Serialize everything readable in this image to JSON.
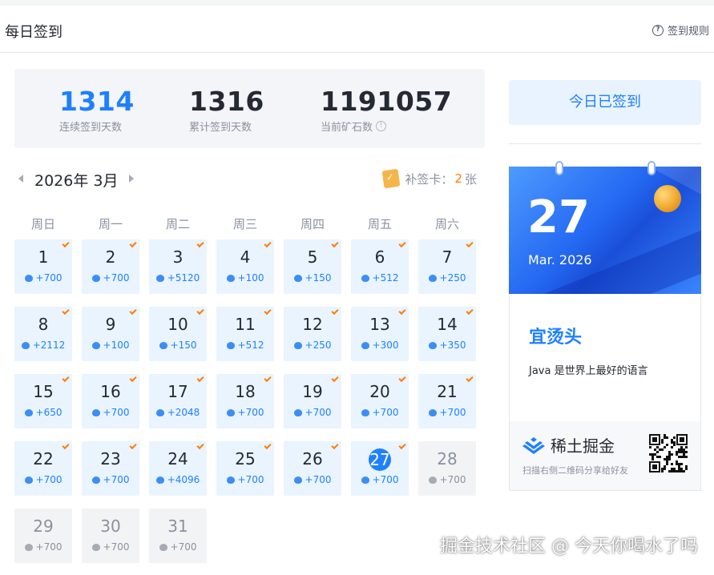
{
  "header": {
    "title": "每日签到",
    "rules_label": "签到规则"
  },
  "stats": [
    {
      "value": "1314",
      "label": "连续签到天数",
      "color": "#1e80ff"
    },
    {
      "value": "1316",
      "label": "累计签到天数",
      "color": "#252933"
    },
    {
      "value": "1191057",
      "label": "当前矿石数",
      "color": "#252933",
      "info": true
    }
  ],
  "calendar": {
    "month_label": "2026年 3月",
    "makeup_card_label": "补签卡：",
    "makeup_card_count": "2",
    "makeup_card_unit": "张",
    "weekdays": [
      "周日",
      "周一",
      "周二",
      "周三",
      "周四",
      "周五",
      "周六"
    ],
    "days": [
      {
        "d": "1",
        "ore": "+700",
        "state": "signed"
      },
      {
        "d": "2",
        "ore": "+700",
        "state": "signed"
      },
      {
        "d": "3",
        "ore": "+5120",
        "state": "signed"
      },
      {
        "d": "4",
        "ore": "+100",
        "state": "signed"
      },
      {
        "d": "5",
        "ore": "+150",
        "state": "signed"
      },
      {
        "d": "6",
        "ore": "+512",
        "state": "signed"
      },
      {
        "d": "7",
        "ore": "+250",
        "state": "signed"
      },
      {
        "d": "8",
        "ore": "+2112",
        "state": "signed"
      },
      {
        "d": "9",
        "ore": "+100",
        "state": "signed"
      },
      {
        "d": "10",
        "ore": "+150",
        "state": "signed"
      },
      {
        "d": "11",
        "ore": "+512",
        "state": "signed"
      },
      {
        "d": "12",
        "ore": "+250",
        "state": "signed"
      },
      {
        "d": "13",
        "ore": "+300",
        "state": "signed"
      },
      {
        "d": "14",
        "ore": "+350",
        "state": "signed"
      },
      {
        "d": "15",
        "ore": "+650",
        "state": "signed"
      },
      {
        "d": "16",
        "ore": "+700",
        "state": "signed"
      },
      {
        "d": "17",
        "ore": "+2048",
        "state": "signed"
      },
      {
        "d": "18",
        "ore": "+700",
        "state": "signed"
      },
      {
        "d": "19",
        "ore": "+700",
        "state": "signed"
      },
      {
        "d": "20",
        "ore": "+700",
        "state": "signed"
      },
      {
        "d": "21",
        "ore": "+700",
        "state": "signed"
      },
      {
        "d": "22",
        "ore": "+700",
        "state": "signed"
      },
      {
        "d": "23",
        "ore": "+700",
        "state": "signed"
      },
      {
        "d": "24",
        "ore": "+4096",
        "state": "signed"
      },
      {
        "d": "25",
        "ore": "+700",
        "state": "signed"
      },
      {
        "d": "26",
        "ore": "+700",
        "state": "signed"
      },
      {
        "d": "27",
        "ore": "+700",
        "state": "today"
      },
      {
        "d": "28",
        "ore": "+700",
        "state": "future"
      },
      {
        "d": "29",
        "ore": "+700",
        "state": "future"
      },
      {
        "d": "30",
        "ore": "+700",
        "state": "future"
      },
      {
        "d": "31",
        "ore": "+700",
        "state": "future"
      }
    ]
  },
  "side": {
    "signed_button": "今日已签到",
    "banner_day": "27",
    "banner_date": "Mar. 2026",
    "luck": "宜烫头",
    "quote": "Java 是世界上最好的语言",
    "brand": "稀土掘金",
    "share_text": "扫描右侧二维码分享给好友"
  },
  "watermark": "掘金技术社区 @ 今天你喝水了吗",
  "colors": {
    "accent": "#1e80ff",
    "signed_bg": "#e9f4ff",
    "future_bg": "#f2f3f5",
    "check": "#ff7d00"
  }
}
